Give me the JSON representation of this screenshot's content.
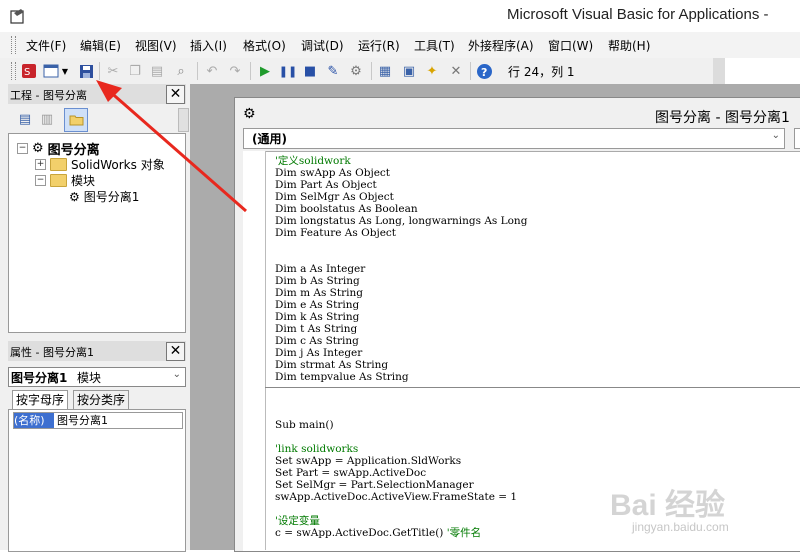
{
  "window": {
    "title": "Microsoft Visual Basic for Applications -"
  },
  "menu": [
    "文件(F)",
    "编辑(E)",
    "视图(V)",
    "插入(I)",
    "格式(O)",
    "调试(D)",
    "运行(R)",
    "工具(T)",
    "外接程序(A)",
    "窗口(W)",
    "帮助(H)"
  ],
  "toolbar": {
    "cursor_position": "行 24，列 1"
  },
  "project_pane": {
    "title": "工程 - 图号分离",
    "tree": {
      "root": "图号分离",
      "objects": "SolidWorks 对象",
      "modules": "模块",
      "module": "图号分离1"
    }
  },
  "properties_pane": {
    "title": "属性 - 图号分离1",
    "object_name": "图号分离1",
    "object_type": "模块",
    "tab_alpha": "按字母序",
    "tab_category": "按分类序",
    "prop_name": "(名称)",
    "prop_value": "图号分离1"
  },
  "code_window": {
    "title": "图号分离 - 图号分离1",
    "object_combo": "(通用)",
    "lines_top": [
      "'定义solidwork",
      "Dim swApp As Object",
      "Dim Part As Object",
      "Dim SelMgr As Object",
      "Dim boolstatus As Boolean",
      "Dim longstatus As Long, longwarnings As Long",
      "Dim Feature As Object",
      "",
      "",
      "Dim a As Integer",
      "Dim b As String",
      "Dim m As String",
      "Dim e As String",
      "Dim k As String",
      "Dim t As String",
      "Dim c As String",
      "Dim j As Integer",
      "Dim strmat As String",
      "Dim tempvalue As String"
    ],
    "lines_bottom": [
      "Sub main()",
      "",
      "'link solidworks",
      "Set swApp = Application.SldWorks",
      "Set Part = swApp.ActiveDoc",
      "Set SelMgr = Part.SelectionManager",
      "swApp.ActiveDoc.ActiveView.FrameState = 1",
      "",
      "'设定变量",
      "c = swApp.ActiveDoc.GetTitle() '零件名"
    ]
  },
  "watermark": {
    "main": "Bai 经验",
    "sub": "jingyan.baidu.com"
  },
  "colors": {
    "comment": "#007a00",
    "arrow": "#e8281e"
  }
}
